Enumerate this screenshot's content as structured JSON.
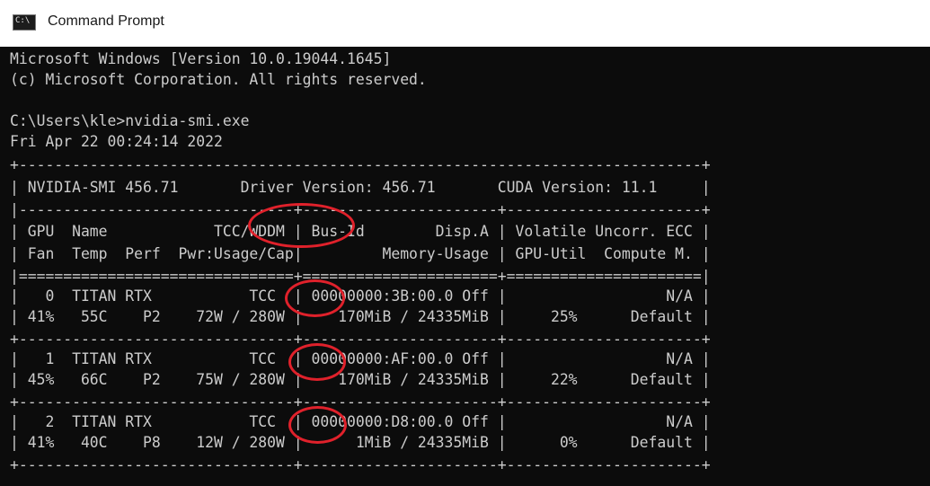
{
  "window": {
    "title": "Command Prompt",
    "icon": "console-icon",
    "icon_glyph": "C:\\"
  },
  "console": {
    "lines": [
      "Microsoft Windows [Version 10.0.19044.1645]",
      "(c) Microsoft Corporation. All rights reserved.",
      "",
      "C:\\Users\\kle>nvidia-smi.exe",
      "Fri Apr 22 00:24:14 2022",
      "+-----------------------------------------------------------------------------+",
      "| NVIDIA-SMI 456.71       Driver Version: 456.71       CUDA Version: 11.1     |",
      "|-------------------------------+----------------------+----------------------+",
      "| GPU  Name            TCC/WDDM | Bus-Id        Disp.A | Volatile Uncorr. ECC |",
      "| Fan  Temp  Perf  Pwr:Usage/Cap|         Memory-Usage | GPU-Util  Compute M. |",
      "|===============================+======================+======================|",
      "|   0  TITAN RTX           TCC  | 00000000:3B:00.0 Off |                  N/A |",
      "| 41%   55C    P2    72W / 280W |    170MiB / 24335MiB |     25%      Default |",
      "+-------------------------------+----------------------+----------------------+",
      "|   1  TITAN RTX           TCC  | 00000000:AF:00.0 Off |                  N/A |",
      "| 45%   66C    P2    75W / 280W |    170MiB / 24335MiB |     22%      Default |",
      "+-------------------------------+----------------------+----------------------+",
      "|   2  TITAN RTX           TCC  | 00000000:D8:00.0 Off |                  N/A |",
      "| 41%   40C    P8    12W / 280W |      1MiB / 24335MiB |      0%      Default |",
      "+-------------------------------+----------------------+----------------------+"
    ]
  },
  "annotations": {
    "highlight_color": "#e0212b",
    "highlighted_items": [
      "TCC/WDDM",
      "TCC",
      "TCC",
      "TCC"
    ]
  }
}
